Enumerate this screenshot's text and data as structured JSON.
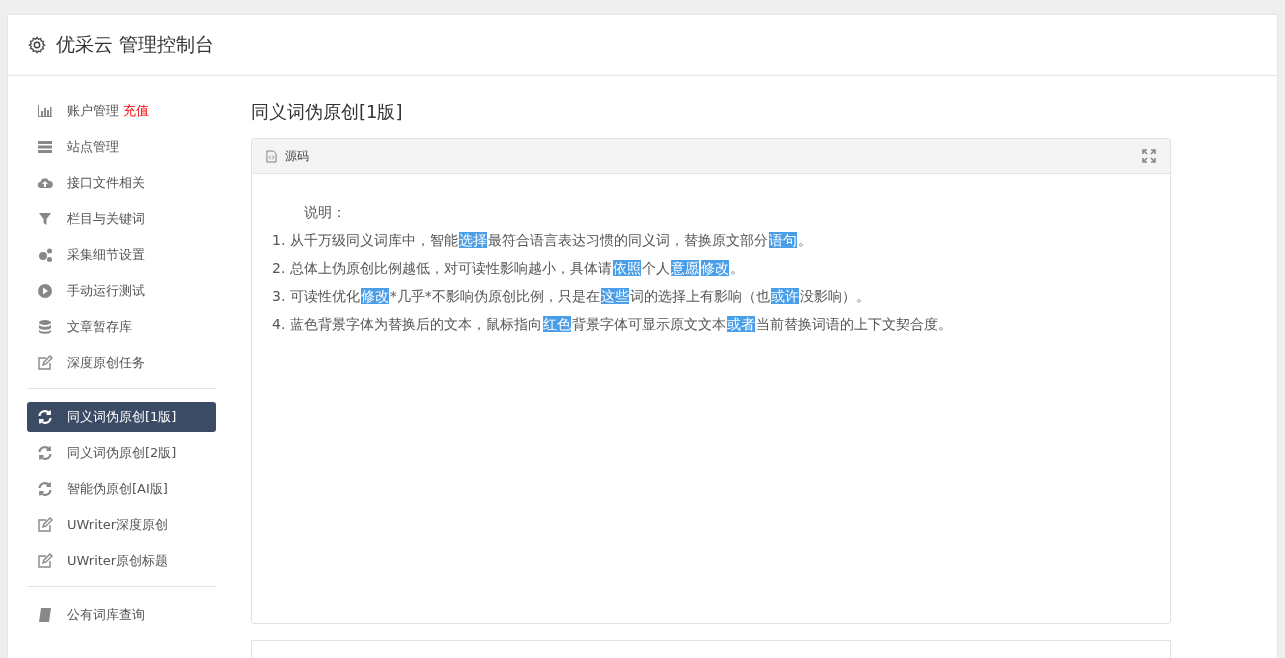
{
  "header": {
    "title": "优采云 管理控制台"
  },
  "sidebar": {
    "groups": [
      {
        "items": [
          {
            "label": "账户管理",
            "badge": "充值",
            "selected": false
          },
          {
            "label": "站点管理",
            "selected": false
          },
          {
            "label": "接口文件相关",
            "selected": false
          },
          {
            "label": "栏目与关键词",
            "selected": false
          },
          {
            "label": "采集细节设置",
            "selected": false
          },
          {
            "label": "手动运行测试",
            "selected": false
          },
          {
            "label": "文章暂存库",
            "selected": false
          },
          {
            "label": "深度原创任务",
            "selected": false
          }
        ]
      },
      {
        "items": [
          {
            "label": "同义词伪原创[1版]",
            "selected": true
          },
          {
            "label": "同义词伪原创[2版]",
            "selected": false
          },
          {
            "label": "智能伪原创[AI版]",
            "selected": false
          },
          {
            "label": "UWriter深度原创",
            "selected": false
          },
          {
            "label": "UWriter原创标题",
            "selected": false
          }
        ]
      },
      {
        "items": [
          {
            "label": "公有词库查询",
            "selected": false
          }
        ]
      }
    ]
  },
  "main": {
    "title": "同义词伪原创[1版]",
    "panel": {
      "tab": "源码",
      "intro": "说明：",
      "lines": [
        [
          {
            "text": "1. 从千万级同义词库中，智能",
            "highlight": false
          },
          {
            "text": "选择",
            "highlight": true
          },
          {
            "text": "最符合语言表达习惯的同义词，替换原文部分",
            "highlight": false
          },
          {
            "text": "语句",
            "highlight": true
          },
          {
            "text": "。",
            "highlight": false
          }
        ],
        [
          {
            "text": "2. 总体上伪原创比例越低，对可读性影响越小，具体请",
            "highlight": false
          },
          {
            "text": "依照",
            "highlight": true
          },
          {
            "text": "个人",
            "highlight": false
          },
          {
            "text": "意愿",
            "highlight": true
          },
          {
            "text": "修改",
            "highlight": true
          },
          {
            "text": "。",
            "highlight": false
          }
        ],
        [
          {
            "text": "3. 可读性优化",
            "highlight": false
          },
          {
            "text": "修改",
            "highlight": true
          },
          {
            "text": "*几乎*不影响伪原创比例，只是在",
            "highlight": false
          },
          {
            "text": "这些",
            "highlight": true
          },
          {
            "text": "词的选择上有影响（也",
            "highlight": false
          },
          {
            "text": "或许",
            "highlight": true
          },
          {
            "text": "没影响）。",
            "highlight": false
          }
        ],
        [
          {
            "text": "4. 蓝色背景字体为替换后的文本，鼠标指向",
            "highlight": false
          },
          {
            "text": "红色",
            "highlight": true
          },
          {
            "text": "背景字体可显示原文文本",
            "highlight": false
          },
          {
            "text": "或者",
            "highlight": true
          },
          {
            "text": "当前替换词语的上下文契合度。",
            "highlight": false
          }
        ]
      ]
    }
  }
}
